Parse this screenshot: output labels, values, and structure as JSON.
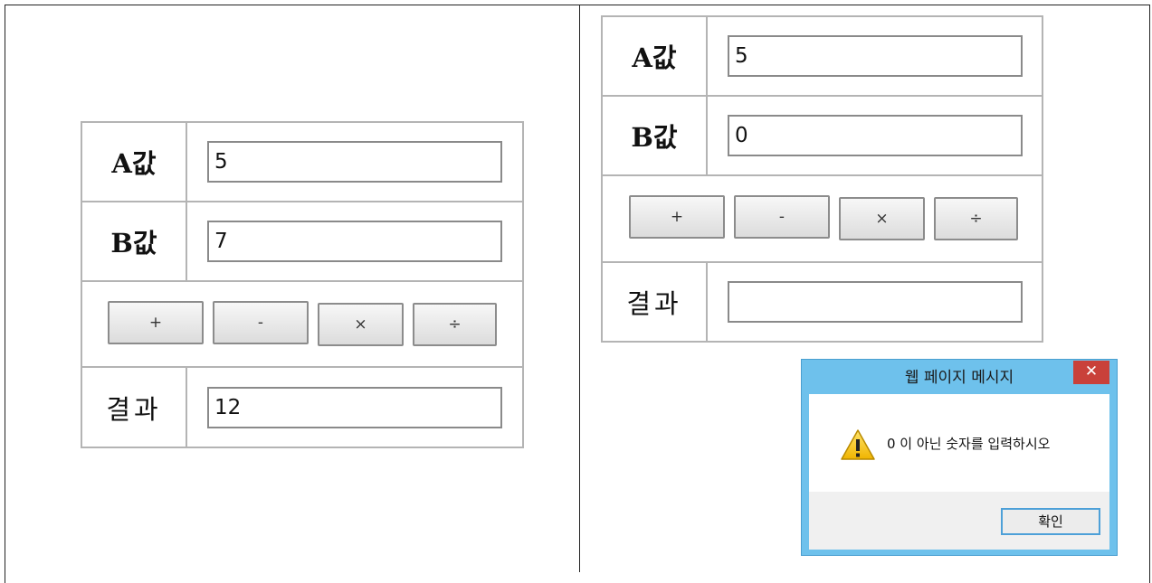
{
  "left_form": {
    "a_label": "A값",
    "b_label": "B값",
    "a_value": "5",
    "b_value": "7",
    "result_label": "결과",
    "result_value": "12",
    "buttons": {
      "add": "+",
      "sub": "-",
      "mul": "×",
      "div": "÷"
    }
  },
  "right_form": {
    "a_label": "A값",
    "b_label": "B값",
    "a_value": "5",
    "b_value": "0",
    "result_label": "결과",
    "result_value": "",
    "buttons": {
      "add": "+",
      "sub": "-",
      "mul": "×",
      "div": "÷"
    }
  },
  "dialog": {
    "title": "웹 페이지 메시지",
    "close_glyph": "✕",
    "message": "0 이 아닌 숫자를 입력하시오",
    "ok_label": "확인",
    "icon": "warning-icon"
  },
  "colors": {
    "dialog_frame": "#6ec1ec",
    "close_button": "#c9413a",
    "warning_yellow": "#f2c200"
  }
}
